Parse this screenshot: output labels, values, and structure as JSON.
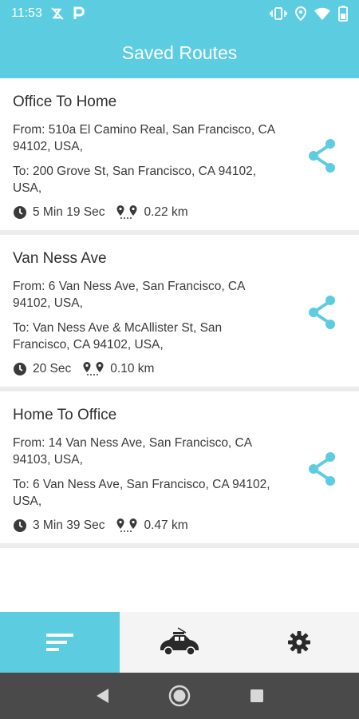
{
  "status_bar": {
    "time": "11:53",
    "left_icons": [
      "no-sync-icon",
      "parking-p-icon"
    ],
    "right_icons": [
      "vibrate-icon",
      "location-icon",
      "wifi-icon",
      "battery-icon"
    ]
  },
  "header": {
    "title": "Saved Routes"
  },
  "routes": [
    {
      "title": "Office To Home",
      "from": "From: 510a El Camino Real, San Francisco, CA 94102, USA,",
      "to": "To: 200 Grove St, San Francisco, CA 94102, USA,",
      "duration": "5 Min 19 Sec",
      "distance": "0.22 km"
    },
    {
      "title": "Van Ness Ave",
      "from": "From: 6 Van Ness Ave, San Francisco, CA 94102, USA,",
      "to": "To: Van Ness Ave & McAllister St, San Francisco, CA 94102, USA,",
      "duration": "20 Sec",
      "distance": "0.10 km"
    },
    {
      "title": "Home To Office",
      "from": "From: 14 Van Ness Ave, San Francisco, CA 94103, USA,",
      "to": "To: 6 Van Ness Ave, San Francisco, CA 94102, USA,",
      "duration": "3 Min 39 Sec",
      "distance": "0.47 km"
    }
  ],
  "bottom_nav": {
    "tabs": [
      {
        "icon": "list-icon",
        "active": true
      },
      {
        "icon": "car-icon",
        "active": false
      },
      {
        "icon": "gear-icon",
        "active": false
      }
    ]
  },
  "system_nav": {
    "buttons": [
      "back-icon",
      "home-icon",
      "recents-icon"
    ]
  },
  "colors": {
    "accent": "#5ccde0",
    "text": "#2f2f2f",
    "divider": "#ececec",
    "system_nav": "#4a4a4a"
  }
}
